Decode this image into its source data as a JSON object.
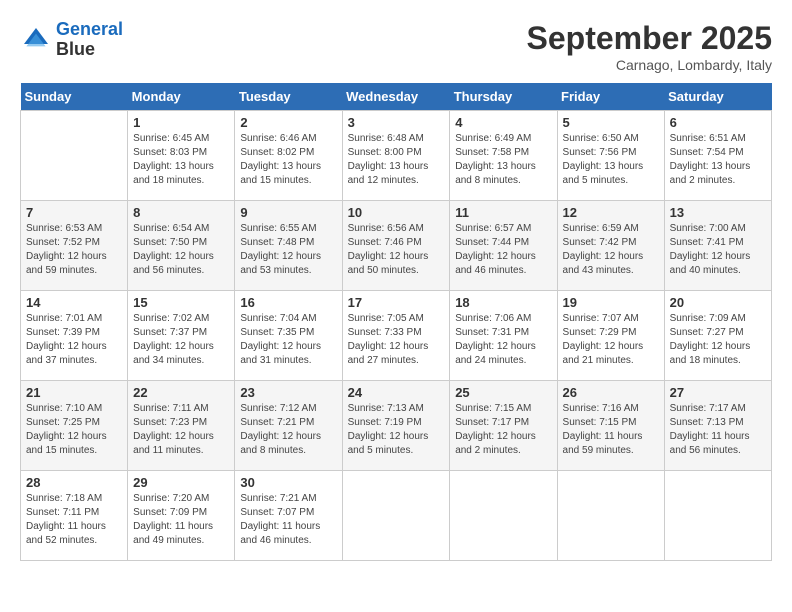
{
  "header": {
    "logo_line1": "General",
    "logo_line2": "Blue",
    "month": "September 2025",
    "location": "Carnago, Lombardy, Italy"
  },
  "days_of_week": [
    "Sunday",
    "Monday",
    "Tuesday",
    "Wednesday",
    "Thursday",
    "Friday",
    "Saturday"
  ],
  "weeks": [
    [
      {
        "day": "",
        "sunrise": "",
        "sunset": "",
        "daylight": ""
      },
      {
        "day": "1",
        "sunrise": "Sunrise: 6:45 AM",
        "sunset": "Sunset: 8:03 PM",
        "daylight": "Daylight: 13 hours and 18 minutes."
      },
      {
        "day": "2",
        "sunrise": "Sunrise: 6:46 AM",
        "sunset": "Sunset: 8:02 PM",
        "daylight": "Daylight: 13 hours and 15 minutes."
      },
      {
        "day": "3",
        "sunrise": "Sunrise: 6:48 AM",
        "sunset": "Sunset: 8:00 PM",
        "daylight": "Daylight: 13 hours and 12 minutes."
      },
      {
        "day": "4",
        "sunrise": "Sunrise: 6:49 AM",
        "sunset": "Sunset: 7:58 PM",
        "daylight": "Daylight: 13 hours and 8 minutes."
      },
      {
        "day": "5",
        "sunrise": "Sunrise: 6:50 AM",
        "sunset": "Sunset: 7:56 PM",
        "daylight": "Daylight: 13 hours and 5 minutes."
      },
      {
        "day": "6",
        "sunrise": "Sunrise: 6:51 AM",
        "sunset": "Sunset: 7:54 PM",
        "daylight": "Daylight: 13 hours and 2 minutes."
      }
    ],
    [
      {
        "day": "7",
        "sunrise": "Sunrise: 6:53 AM",
        "sunset": "Sunset: 7:52 PM",
        "daylight": "Daylight: 12 hours and 59 minutes."
      },
      {
        "day": "8",
        "sunrise": "Sunrise: 6:54 AM",
        "sunset": "Sunset: 7:50 PM",
        "daylight": "Daylight: 12 hours and 56 minutes."
      },
      {
        "day": "9",
        "sunrise": "Sunrise: 6:55 AM",
        "sunset": "Sunset: 7:48 PM",
        "daylight": "Daylight: 12 hours and 53 minutes."
      },
      {
        "day": "10",
        "sunrise": "Sunrise: 6:56 AM",
        "sunset": "Sunset: 7:46 PM",
        "daylight": "Daylight: 12 hours and 50 minutes."
      },
      {
        "day": "11",
        "sunrise": "Sunrise: 6:57 AM",
        "sunset": "Sunset: 7:44 PM",
        "daylight": "Daylight: 12 hours and 46 minutes."
      },
      {
        "day": "12",
        "sunrise": "Sunrise: 6:59 AM",
        "sunset": "Sunset: 7:42 PM",
        "daylight": "Daylight: 12 hours and 43 minutes."
      },
      {
        "day": "13",
        "sunrise": "Sunrise: 7:00 AM",
        "sunset": "Sunset: 7:41 PM",
        "daylight": "Daylight: 12 hours and 40 minutes."
      }
    ],
    [
      {
        "day": "14",
        "sunrise": "Sunrise: 7:01 AM",
        "sunset": "Sunset: 7:39 PM",
        "daylight": "Daylight: 12 hours and 37 minutes."
      },
      {
        "day": "15",
        "sunrise": "Sunrise: 7:02 AM",
        "sunset": "Sunset: 7:37 PM",
        "daylight": "Daylight: 12 hours and 34 minutes."
      },
      {
        "day": "16",
        "sunrise": "Sunrise: 7:04 AM",
        "sunset": "Sunset: 7:35 PM",
        "daylight": "Daylight: 12 hours and 31 minutes."
      },
      {
        "day": "17",
        "sunrise": "Sunrise: 7:05 AM",
        "sunset": "Sunset: 7:33 PM",
        "daylight": "Daylight: 12 hours and 27 minutes."
      },
      {
        "day": "18",
        "sunrise": "Sunrise: 7:06 AM",
        "sunset": "Sunset: 7:31 PM",
        "daylight": "Daylight: 12 hours and 24 minutes."
      },
      {
        "day": "19",
        "sunrise": "Sunrise: 7:07 AM",
        "sunset": "Sunset: 7:29 PM",
        "daylight": "Daylight: 12 hours and 21 minutes."
      },
      {
        "day": "20",
        "sunrise": "Sunrise: 7:09 AM",
        "sunset": "Sunset: 7:27 PM",
        "daylight": "Daylight: 12 hours and 18 minutes."
      }
    ],
    [
      {
        "day": "21",
        "sunrise": "Sunrise: 7:10 AM",
        "sunset": "Sunset: 7:25 PM",
        "daylight": "Daylight: 12 hours and 15 minutes."
      },
      {
        "day": "22",
        "sunrise": "Sunrise: 7:11 AM",
        "sunset": "Sunset: 7:23 PM",
        "daylight": "Daylight: 12 hours and 11 minutes."
      },
      {
        "day": "23",
        "sunrise": "Sunrise: 7:12 AM",
        "sunset": "Sunset: 7:21 PM",
        "daylight": "Daylight: 12 hours and 8 minutes."
      },
      {
        "day": "24",
        "sunrise": "Sunrise: 7:13 AM",
        "sunset": "Sunset: 7:19 PM",
        "daylight": "Daylight: 12 hours and 5 minutes."
      },
      {
        "day": "25",
        "sunrise": "Sunrise: 7:15 AM",
        "sunset": "Sunset: 7:17 PM",
        "daylight": "Daylight: 12 hours and 2 minutes."
      },
      {
        "day": "26",
        "sunrise": "Sunrise: 7:16 AM",
        "sunset": "Sunset: 7:15 PM",
        "daylight": "Daylight: 11 hours and 59 minutes."
      },
      {
        "day": "27",
        "sunrise": "Sunrise: 7:17 AM",
        "sunset": "Sunset: 7:13 PM",
        "daylight": "Daylight: 11 hours and 56 minutes."
      }
    ],
    [
      {
        "day": "28",
        "sunrise": "Sunrise: 7:18 AM",
        "sunset": "Sunset: 7:11 PM",
        "daylight": "Daylight: 11 hours and 52 minutes."
      },
      {
        "day": "29",
        "sunrise": "Sunrise: 7:20 AM",
        "sunset": "Sunset: 7:09 PM",
        "daylight": "Daylight: 11 hours and 49 minutes."
      },
      {
        "day": "30",
        "sunrise": "Sunrise: 7:21 AM",
        "sunset": "Sunset: 7:07 PM",
        "daylight": "Daylight: 11 hours and 46 minutes."
      },
      {
        "day": "",
        "sunrise": "",
        "sunset": "",
        "daylight": ""
      },
      {
        "day": "",
        "sunrise": "",
        "sunset": "",
        "daylight": ""
      },
      {
        "day": "",
        "sunrise": "",
        "sunset": "",
        "daylight": ""
      },
      {
        "day": "",
        "sunrise": "",
        "sunset": "",
        "daylight": ""
      }
    ]
  ]
}
